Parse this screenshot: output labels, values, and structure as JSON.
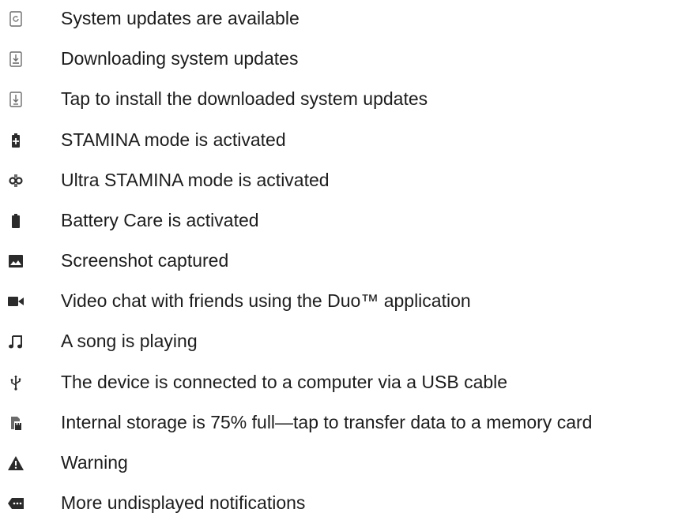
{
  "notifications": [
    {
      "icon": "system-update-available-icon",
      "text": "System updates are available"
    },
    {
      "icon": "system-update-downloading-icon",
      "text": "Downloading system updates"
    },
    {
      "icon": "system-update-install-icon",
      "text": "Tap to install the downloaded system updates"
    },
    {
      "icon": "stamina-battery-icon",
      "text": "STAMINA mode is activated"
    },
    {
      "icon": "ultra-stamina-icon",
      "text": "Ultra STAMINA mode is activated"
    },
    {
      "icon": "battery-care-icon",
      "text": "Battery Care is activated"
    },
    {
      "icon": "screenshot-image-icon",
      "text": "Screenshot captured"
    },
    {
      "icon": "video-camera-icon",
      "text": "Video chat with friends using the Duo™ application"
    },
    {
      "icon": "music-note-icon",
      "text": "A song is playing"
    },
    {
      "icon": "usb-icon",
      "text": "The device is connected to a computer via a USB cable"
    },
    {
      "icon": "storage-card-icon",
      "text": "Internal storage is 75% full—tap to transfer data to a memory card"
    },
    {
      "icon": "warning-icon",
      "text": "Warning"
    },
    {
      "icon": "more-notifications-icon",
      "text": "More undisplayed notifications"
    }
  ],
  "colors": {
    "text": "#1d1d1d",
    "icon": "#2b2b2b",
    "icon_light": "#6b6b6b"
  }
}
